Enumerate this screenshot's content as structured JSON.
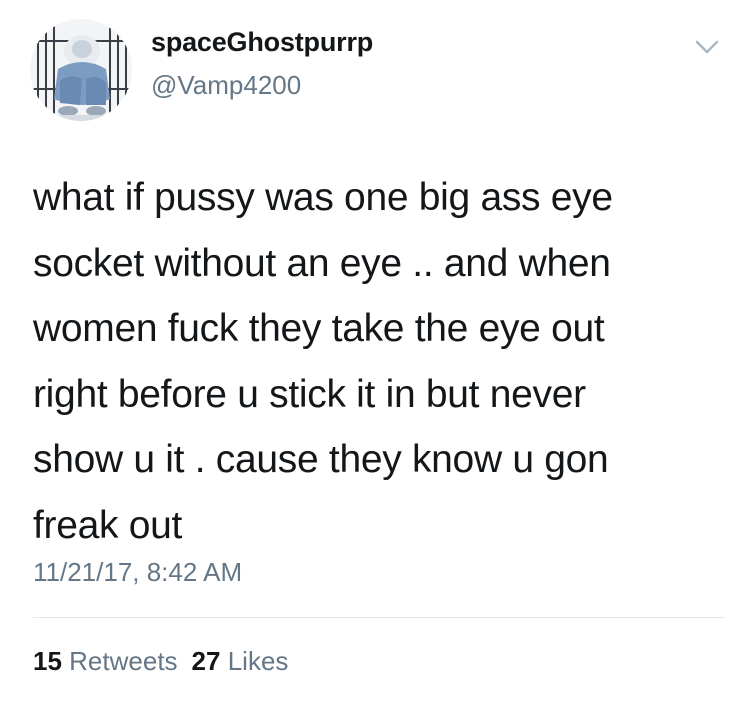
{
  "user": {
    "display_name": "spaceGhostpurrp",
    "handle": "@Vamp4200"
  },
  "menu_icon": "chevron-down-icon",
  "tweet": {
    "lines": [
      "what if pussy was one big ass eye",
      "socket without an eye .. and when",
      "women fuck they take the eye out",
      "right before u stick it in but never",
      "show u it . cause they know u gon",
      "freak out"
    ],
    "timestamp": "11/21/17, 8:42 AM"
  },
  "stats": {
    "retweets_count": "15",
    "retweets_label": "Retweets",
    "likes_count": "27",
    "likes_label": "Likes"
  },
  "colors": {
    "text": "#14171a",
    "secondary": "#657786",
    "divider": "#e1e8ed"
  }
}
